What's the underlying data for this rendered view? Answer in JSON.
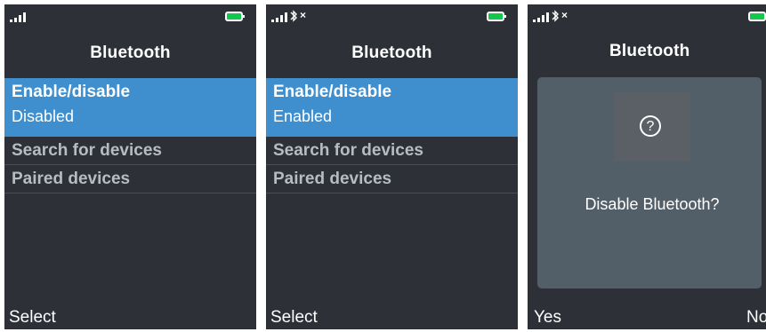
{
  "screens": [
    {
      "title": "Bluetooth",
      "menu": [
        {
          "label": "Enable/disable",
          "value": "Disabled",
          "selected": true
        },
        {
          "label": "Search for devices"
        },
        {
          "label": "Paired devices"
        }
      ],
      "softkeys": {
        "left": "Select"
      },
      "status": {
        "bluetooth_indicator": false,
        "battery_color": "#12c94b"
      }
    },
    {
      "title": "Bluetooth",
      "menu": [
        {
          "label": "Enable/disable",
          "value": "Enabled",
          "selected": true
        },
        {
          "label": "Search for devices"
        },
        {
          "label": "Paired devices"
        }
      ],
      "softkeys": {
        "left": "Select"
      },
      "status": {
        "bluetooth_indicator": true,
        "bluetooth_off_mark": "×",
        "battery_color": "#12c94b"
      }
    },
    {
      "title": "Bluetooth",
      "dialog": {
        "icon": "question-icon",
        "icon_glyph": "?",
        "message": "Disable Bluetooth?"
      },
      "softkeys": {
        "left": "Yes",
        "right": "No"
      },
      "status": {
        "bluetooth_indicator": true,
        "bluetooth_off_mark": "×",
        "battery_color": "#12c94b"
      }
    }
  ],
  "colors": {
    "background": "#2d3137",
    "selected_row": "#3f8fce",
    "inactive_text": "#b7bcc2",
    "dialog": "#535f68"
  }
}
